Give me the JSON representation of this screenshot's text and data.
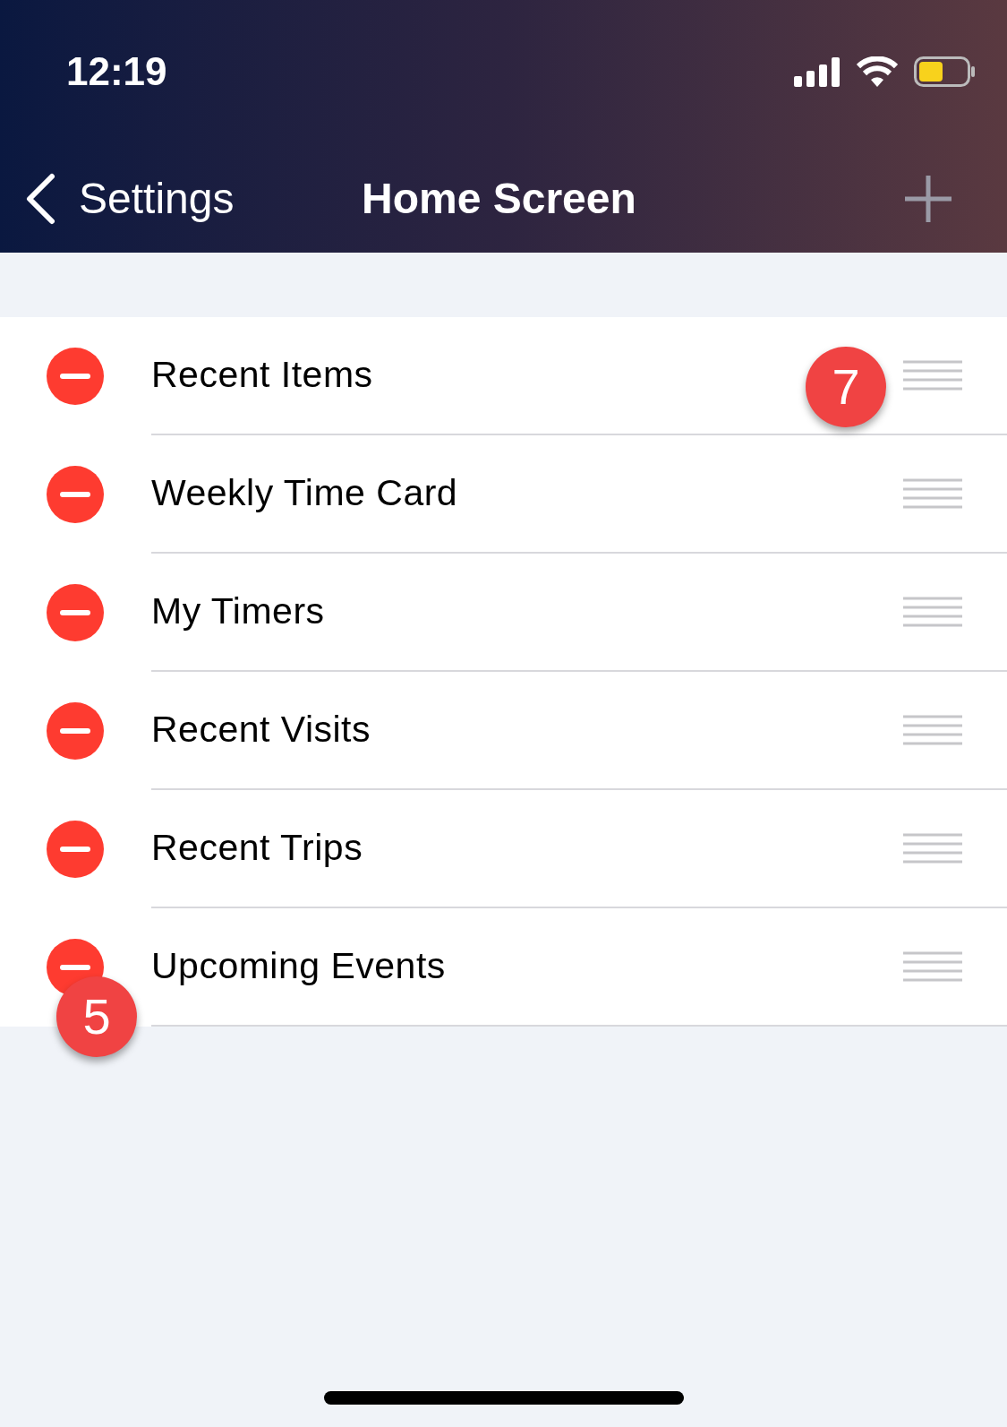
{
  "status_bar": {
    "time": "12:19"
  },
  "nav": {
    "back_label": "Settings",
    "title": "Home Screen"
  },
  "items": [
    {
      "label": "Recent Items",
      "handle_callout": "7"
    },
    {
      "label": "Weekly Time Card"
    },
    {
      "label": "My Timers"
    },
    {
      "label": "Recent Visits"
    },
    {
      "label": "Recent Trips"
    },
    {
      "label": "Upcoming Events",
      "remove_callout": "5"
    }
  ]
}
